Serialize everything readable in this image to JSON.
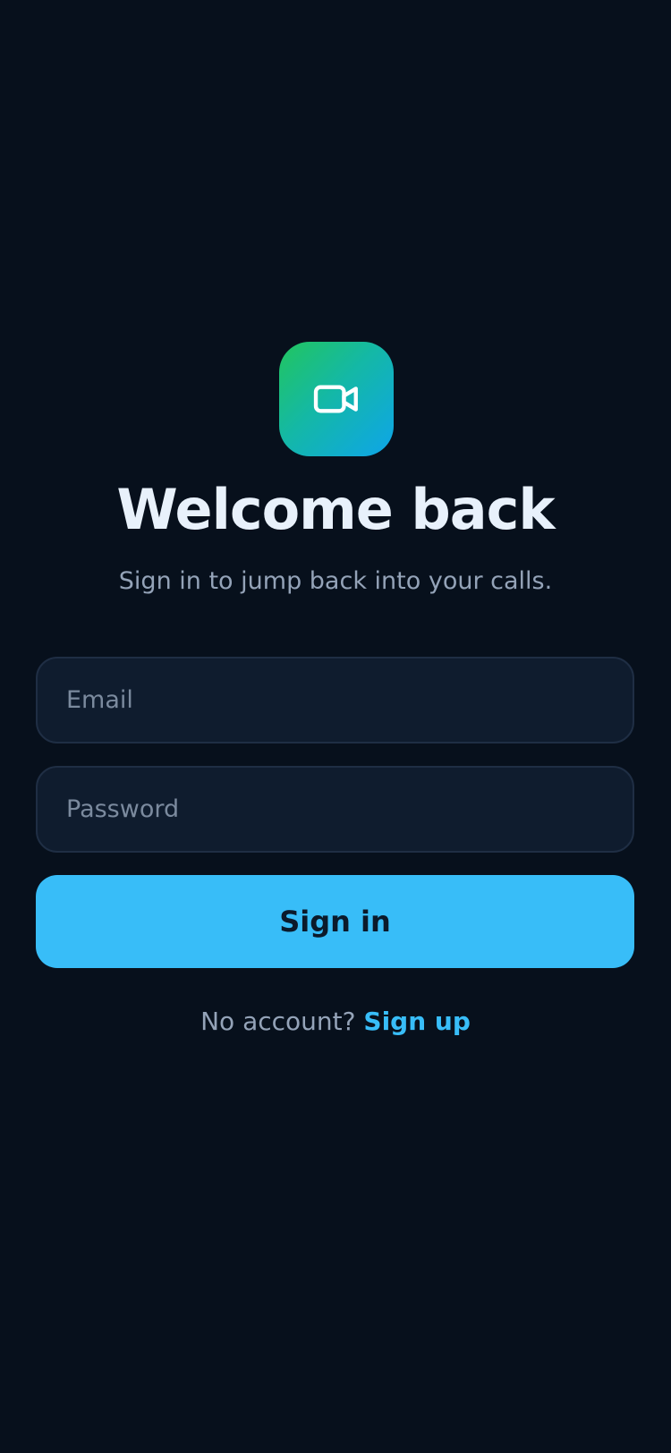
{
  "app": {
    "icon": "video-camera-icon",
    "icon_gradient": [
      "#22c55e",
      "#0ea5e9"
    ]
  },
  "header": {
    "title": "Welcome back",
    "subtitle": "Sign in to jump back into your calls."
  },
  "form": {
    "email_placeholder": "Email",
    "email_value": "",
    "password_placeholder": "Password",
    "password_value": "",
    "submit_label": "Sign in"
  },
  "footer": {
    "prompt": "No account?",
    "link_label": "Sign up"
  },
  "colors": {
    "background": "#07101c",
    "accent": "#38bdf8",
    "field_background": "#0f1c2e",
    "field_border": "#1f2e44"
  }
}
